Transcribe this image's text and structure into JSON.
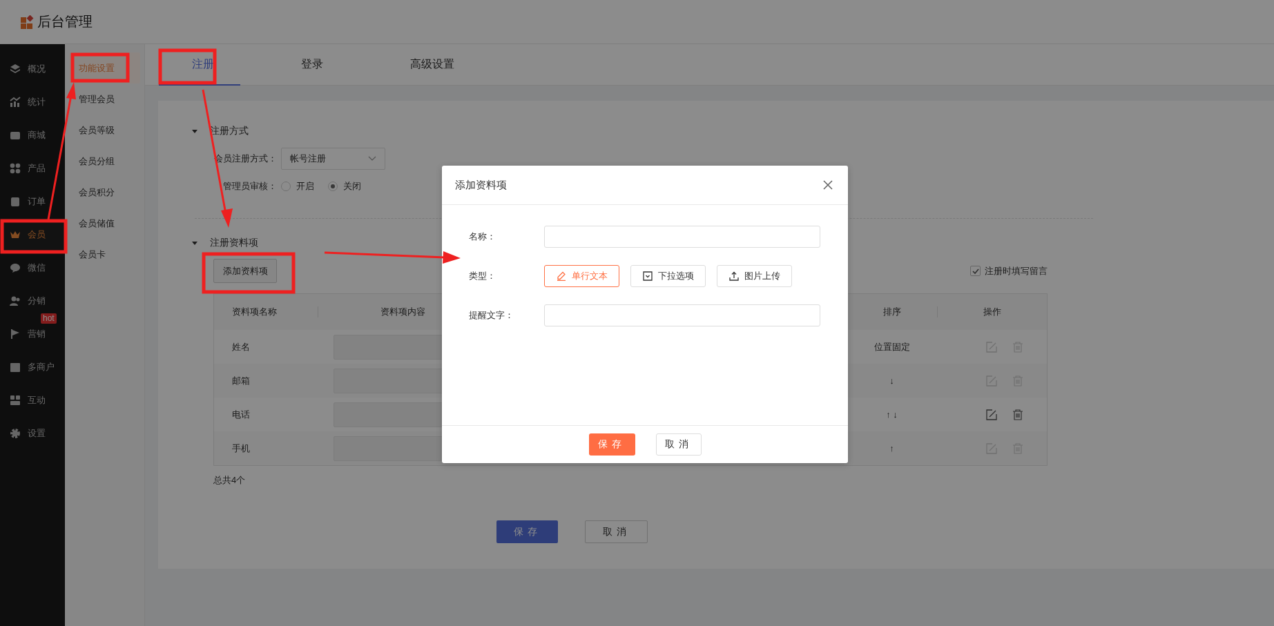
{
  "header": {
    "title": "后台管理"
  },
  "sidebar": {
    "items": [
      {
        "label": "概况",
        "selected": false
      },
      {
        "label": "统计",
        "selected": false
      },
      {
        "label": "商城",
        "selected": false
      },
      {
        "label": "产品",
        "selected": false
      },
      {
        "label": "订单",
        "selected": false
      },
      {
        "label": "会员",
        "selected": true
      },
      {
        "label": "微信",
        "selected": false
      },
      {
        "label": "分销",
        "selected": false
      },
      {
        "label": "营销",
        "selected": false,
        "badge": "hot"
      },
      {
        "label": "多商户",
        "selected": false
      },
      {
        "label": "互动",
        "selected": false
      },
      {
        "label": "设置",
        "selected": false
      }
    ]
  },
  "submenu": {
    "items": [
      {
        "label": "功能设置",
        "selected": true
      },
      {
        "label": "管理会员",
        "selected": false
      },
      {
        "label": "会员等级",
        "selected": false
      },
      {
        "label": "会员分组",
        "selected": false
      },
      {
        "label": "会员积分",
        "selected": false
      },
      {
        "label": "会员储值",
        "selected": false
      },
      {
        "label": "会员卡",
        "selected": false
      }
    ]
  },
  "tabs": [
    {
      "label": "注册",
      "selected": true
    },
    {
      "label": "登录",
      "selected": false
    },
    {
      "label": "高级设置",
      "selected": false
    }
  ],
  "registration_method": {
    "title": "注册方式",
    "expanded": true,
    "method_label": "会员注册方式：",
    "method_value": "帐号注册",
    "review_label": "管理员审核：",
    "review_options": [
      {
        "label": "开启",
        "selected": false
      },
      {
        "label": "关闭",
        "selected": true
      }
    ]
  },
  "registration_fields": {
    "title": "注册资料项",
    "expanded": true,
    "add_button": "添加资料项",
    "message_checkbox": {
      "label": "注册时填写留言",
      "checked": true
    },
    "table": {
      "columns": [
        "资料项名称",
        "资料项内容",
        "排序",
        "操作"
      ],
      "rows": [
        {
          "name": "姓名",
          "sort": "位置固定",
          "actions_enabled": false
        },
        {
          "name": "邮箱",
          "sort": "↓",
          "actions_enabled": false
        },
        {
          "name": "电话",
          "sort": "↑ ↓",
          "actions_enabled": true
        },
        {
          "name": "手机",
          "sort": "↑",
          "actions_enabled": false
        }
      ]
    },
    "total": "总共4个"
  },
  "actions": {
    "save": "保存",
    "cancel": "取消"
  },
  "modal": {
    "title": "添加资料项",
    "name_label": "名称：",
    "type_label": "类型：",
    "hint_label": "提醒文字：",
    "type_options": [
      {
        "label": "单行文本",
        "selected": true
      },
      {
        "label": "下拉选项",
        "selected": false
      },
      {
        "label": "图片上传",
        "selected": false
      }
    ],
    "save": "保存",
    "cancel": "取消"
  }
}
